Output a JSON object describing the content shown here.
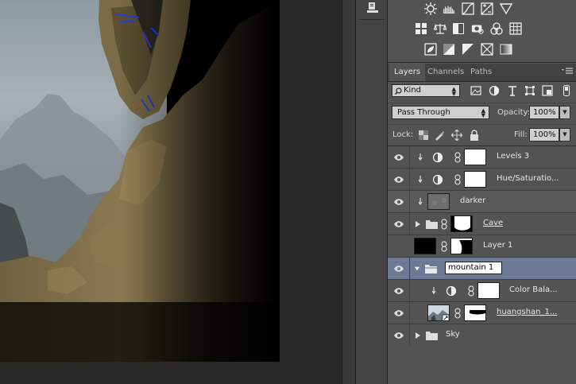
{
  "tabs": [
    {
      "label": "Layers",
      "active": true
    },
    {
      "label": "Channels",
      "active": false
    },
    {
      "label": "Paths",
      "active": false
    }
  ],
  "adjustments": {
    "row1": [
      "brightness-contrast-icon",
      "levels-icon",
      "curves-icon",
      "exposure-icon",
      "gradient-triangle-icon"
    ],
    "row2": [
      "vibrance-icon",
      "balance-icon",
      "black-white-icon",
      "photo-filter-icon",
      "channel-mixer-icon",
      "color-lookup-icon"
    ],
    "row3": [
      "invert-icon",
      "posterize-icon",
      "threshold-icon",
      "selective-color-icon",
      "gradient-map-icon"
    ]
  },
  "filter": {
    "kind_label": "Kind"
  },
  "blend": {
    "mode": "Pass Through",
    "opacity_label": "Opacity:",
    "opacity_value": "100%"
  },
  "lock": {
    "lock_label": "Lock:",
    "fill_label": "Fill:",
    "fill_value": "100%"
  },
  "layers": [
    {
      "name": "Levels 3",
      "type": "adjustment",
      "clipped": true
    },
    {
      "name": "Hue/Saturatio...",
      "type": "adjustment",
      "clipped": true
    },
    {
      "name": "darker",
      "type": "pixel",
      "clipped": true
    },
    {
      "name": "Cave",
      "type": "group",
      "collapsed": true
    },
    {
      "name": "Layer 1",
      "type": "pixel-mask"
    },
    {
      "name": "mountain 1",
      "type": "group-open",
      "selected": true
    },
    {
      "name": "Color Bala...",
      "type": "adjustment",
      "clipped": true
    },
    {
      "name": "huangshan_1...",
      "type": "smart-mask"
    },
    {
      "name": "Sky",
      "type": "group",
      "collapsed": true
    }
  ],
  "colors": {
    "panel": "#535353",
    "selected_row": "#6b7a92",
    "workspace": "#282828"
  }
}
